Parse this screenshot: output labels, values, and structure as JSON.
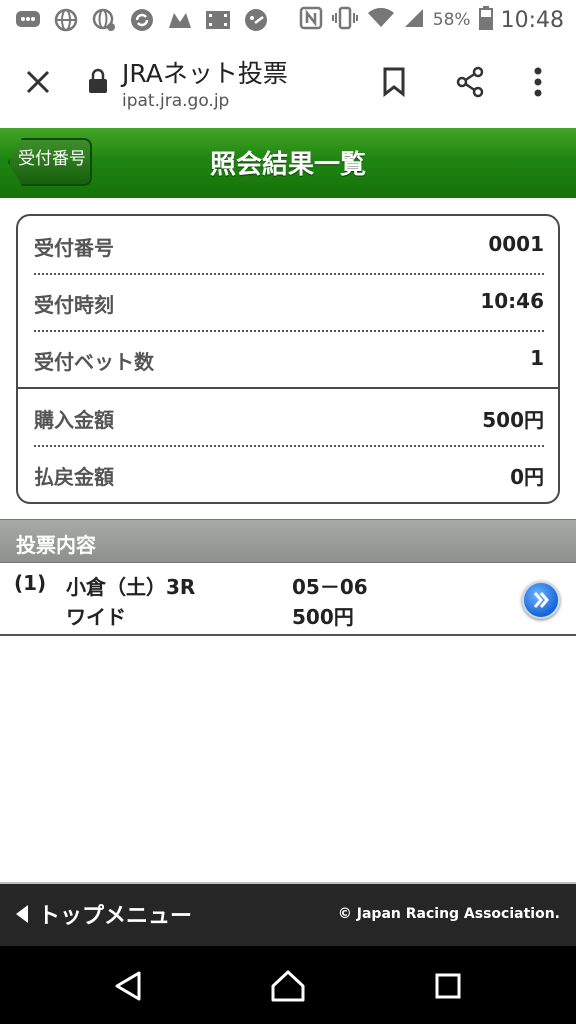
{
  "status_bar": {
    "battery_percent": "58%",
    "time": "10:48",
    "icons": [
      "messaging-icon",
      "globe-icon",
      "globe-settings-icon",
      "sync-icon",
      "m-app-icon",
      "film-icon",
      "emoji-icon",
      "nfc-icon",
      "vibrate-icon",
      "wifi-icon",
      "signal-icon",
      "battery-icon"
    ]
  },
  "browser": {
    "title": "JRAネット投票",
    "url": "ipat.jra.go.jp"
  },
  "header": {
    "back_label": "受付番号",
    "title": "照会結果一覧"
  },
  "info": {
    "rows": [
      {
        "label": "受付番号",
        "value": "0001"
      },
      {
        "label": "受付時刻",
        "value": "10:46"
      },
      {
        "label": "受付ベット数",
        "value": "1"
      },
      {
        "label": "購入金額",
        "value": "500円"
      },
      {
        "label": "払戻金額",
        "value": "0円"
      }
    ]
  },
  "section": {
    "title": "投票内容"
  },
  "votes": [
    {
      "number": "(1)",
      "race": "小倉（土）3R",
      "bet_type": "ワイド",
      "combination": "05－06",
      "amount": "500円"
    }
  ],
  "footer": {
    "menu_label": "トップメニュー",
    "copyright": "© Japan Racing Association."
  },
  "colors": {
    "header_green": "#1f8512",
    "section_gray": "#9a9c99",
    "footer_dark": "#262626",
    "go_button_blue": "#1565d8"
  }
}
